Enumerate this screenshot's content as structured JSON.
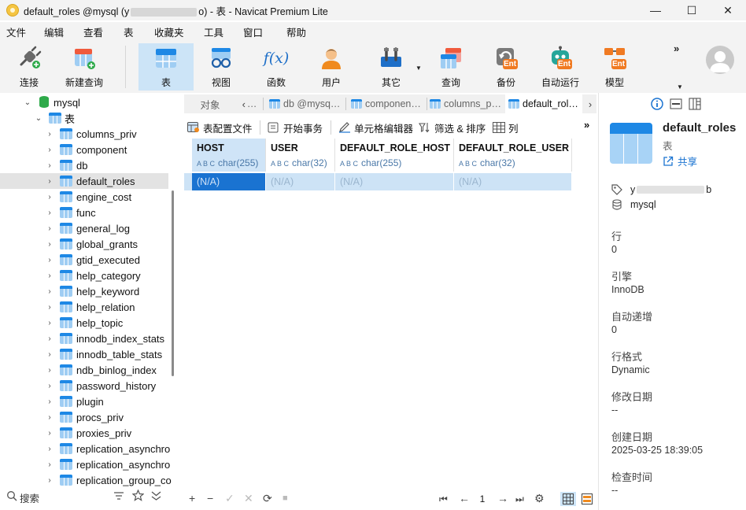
{
  "window": {
    "title_prefix": "default_roles @mysql (y",
    "title_suffix": "o) - 表 - Navicat Premium Lite",
    "controls": [
      "—",
      "☐",
      "✕"
    ]
  },
  "menu": [
    "文件",
    "编辑",
    "查看",
    "表",
    "收藏夹",
    "工具",
    "窗口",
    "帮助"
  ],
  "toolbar": {
    "connect": "连接",
    "new_query": "新建查询",
    "table": "表",
    "view": "视图",
    "function": "函数",
    "user": "用户",
    "other": "其它",
    "query": "查询",
    "backup": "备份",
    "automation": "自动运行",
    "model": "模型",
    "more": "»",
    "ent_badge": "Ent",
    "function_glyph": "f(x)"
  },
  "sidebar": {
    "db_name": "mysql",
    "group_name": "表",
    "tables": [
      "columns_priv",
      "component",
      "db",
      "default_roles",
      "engine_cost",
      "func",
      "general_log",
      "global_grants",
      "gtid_executed",
      "help_category",
      "help_keyword",
      "help_relation",
      "help_topic",
      "innodb_index_stats",
      "innodb_table_stats",
      "ndb_binlog_index",
      "password_history",
      "plugin",
      "procs_priv",
      "proxies_priv",
      "replication_asynchro",
      "replication_asynchro",
      "replication_group_co"
    ],
    "selected_index": 3,
    "search_placeholder": "搜索"
  },
  "tabs": {
    "objects": "对象",
    "items": [
      "…",
      "db @mysq…",
      "componen…",
      "columns_p…",
      "default_rol…"
    ],
    "more": "»"
  },
  "subtoolbar": {
    "config_file": "表配置文件",
    "begin_tx": "开始事务",
    "cell_editor": "单元格编辑器",
    "filter_sort": "筛选 & 排序",
    "columns": "列",
    "more": "»"
  },
  "grid": {
    "columns": [
      {
        "name": "HOST",
        "type": "char(255)"
      },
      {
        "name": "USER",
        "type": "char(32)"
      },
      {
        "name": "DEFAULT_ROLE_HOST",
        "type": "char(255)"
      },
      {
        "name": "DEFAULT_ROLE_USER",
        "type": "char(32)"
      }
    ],
    "type_prefix": "A B C",
    "rows": [
      [
        "(N/A)",
        "(N/A)",
        "(N/A)",
        "(N/A)"
      ]
    ]
  },
  "bottombar": {
    "add": "+",
    "remove": "−",
    "apply": "✓",
    "discard": "✕",
    "refresh": "⟳",
    "stop": "■",
    "first": "⏮",
    "prev": "←",
    "page": "1",
    "next": "→",
    "last": "⏭",
    "settings": "⚙"
  },
  "right_panel": {
    "table_name": "default_roles",
    "type": "表",
    "share": "共享",
    "owner_prefix": "y",
    "owner_suffix": "b",
    "database": "mysql",
    "props": [
      {
        "label": "行",
        "value": "0"
      },
      {
        "label": "引擎",
        "value": "InnoDB"
      },
      {
        "label": "自动递增",
        "value": "0"
      },
      {
        "label": "行格式",
        "value": "Dynamic"
      },
      {
        "label": "修改日期",
        "value": "--"
      },
      {
        "label": "创建日期",
        "value": "2025-03-25 18:39:05"
      },
      {
        "label": "检查时间",
        "value": "--"
      }
    ]
  },
  "colors": {
    "accent": "#1a73d1",
    "selection": "#cde3f6",
    "active_tool": "#cce4f7"
  }
}
